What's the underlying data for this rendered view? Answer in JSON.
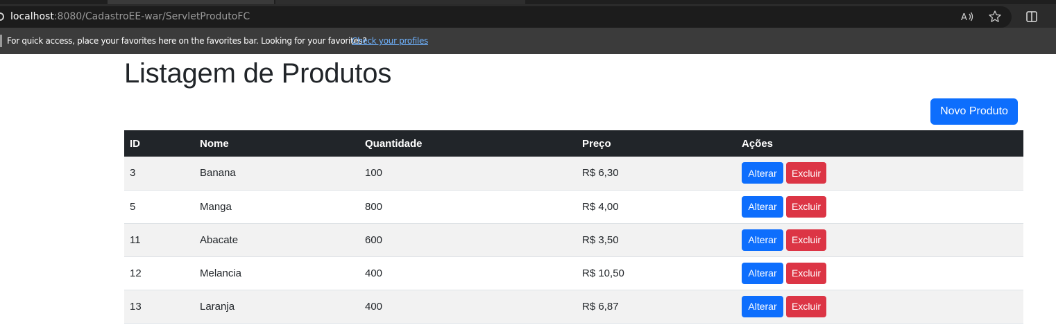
{
  "browser": {
    "url_host": "localhost",
    "url_rest": ":8080/CadastroEE-war/ServletProdutoFC",
    "icons": [
      "read-aloud-icon",
      "favorite-star-icon",
      "split-screen-icon"
    ]
  },
  "favorites_bar": {
    "message": "For quick access, place your favorites here on the favorites bar. Looking for your favorites?",
    "link": "Check your profiles"
  },
  "page": {
    "title": "Listagem de Produtos",
    "new_button": "Novo Produto"
  },
  "table": {
    "headers": [
      "ID",
      "Nome",
      "Quantidade",
      "Preço",
      "Ações"
    ],
    "rows": [
      {
        "id": "3",
        "nome": "Banana",
        "quantidade": "100",
        "preco": "R$ 6,30",
        "alterar": "Alterar",
        "excluir": "Excluir"
      },
      {
        "id": "5",
        "nome": "Manga",
        "quantidade": "800",
        "preco": "R$ 4,00",
        "alterar": "Alterar",
        "excluir": "Excluir"
      },
      {
        "id": "11",
        "nome": "Abacate",
        "quantidade": "600",
        "preco": "R$ 3,50",
        "alterar": "Alterar",
        "excluir": "Excluir"
      },
      {
        "id": "12",
        "nome": "Melancia",
        "quantidade": "400",
        "preco": "R$ 10,50",
        "alterar": "Alterar",
        "excluir": "Excluir"
      },
      {
        "id": "13",
        "nome": "Laranja",
        "quantidade": "400",
        "preco": "R$ 6,87",
        "alterar": "Alterar",
        "excluir": "Excluir"
      }
    ]
  },
  "colors": {
    "primary": "#0d6efd",
    "danger": "#dc3545",
    "table_header": "#212529",
    "stripe": "#f2f2f2"
  }
}
